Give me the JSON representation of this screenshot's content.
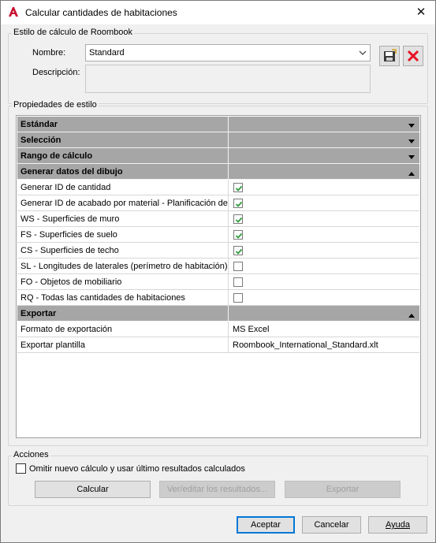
{
  "window": {
    "title": "Calcular cantidades de habitaciones",
    "close_glyph": "✕"
  },
  "style_group": {
    "legend": "Estilo de cálculo de Roombook",
    "name_label": "Nombre:",
    "name_value": "Standard",
    "description_label": "Descripción:",
    "description_value": ""
  },
  "properties": {
    "legend": "Propiedades de estilo",
    "rows": [
      {
        "type": "category",
        "label": "Estándar",
        "expanded": false
      },
      {
        "type": "category",
        "label": "Selección",
        "expanded": false
      },
      {
        "type": "category",
        "label": "Rango de cálculo",
        "expanded": false
      },
      {
        "type": "category",
        "label": "Generar datos del dibujo",
        "expanded": true
      },
      {
        "type": "check",
        "label": "Generar ID de cantidad",
        "checked": true
      },
      {
        "type": "check",
        "label": "Generar ID de acabado por material - Planificación de acabados",
        "checked": true
      },
      {
        "type": "check",
        "label": "WS - Superficies de muro",
        "checked": true
      },
      {
        "type": "check",
        "label": "FS - Superficies de suelo",
        "checked": true
      },
      {
        "type": "check",
        "label": "CS - Superficies de techo",
        "checked": true
      },
      {
        "type": "check",
        "label": "SL - Longitudes de laterales (perímetro de habitación)",
        "checked": false
      },
      {
        "type": "check",
        "label": "FO - Objetos de mobiliario",
        "checked": false
      },
      {
        "type": "check",
        "label": "RQ - Todas las cantidades de habitaciones",
        "checked": false
      },
      {
        "type": "category",
        "label": "Exportar",
        "expanded": true
      },
      {
        "type": "value",
        "label": "Formato de exportación",
        "value": "MS Excel"
      },
      {
        "type": "value",
        "label": "Exportar plantilla",
        "value": "Roombook_International_Standard.xlt"
      }
    ]
  },
  "actions": {
    "legend": "Acciones",
    "skip_checkbox_label": "Omitir nuevo cálculo y usar último resultados calculados",
    "skip_checked": false,
    "calculate_label": "Calcular",
    "view_edit_label": "Ver/editar los resultados...",
    "export_label": "Exportar"
  },
  "footer": {
    "accept_label": "Aceptar",
    "cancel_label": "Cancelar",
    "help_label": "Ayuda"
  },
  "colors": {
    "category_bg": "#a6a6a6",
    "check_color": "#2e9a3a",
    "delete_red": "#e81123",
    "app_red": "#c8102e",
    "default_border": "#0078d7"
  }
}
